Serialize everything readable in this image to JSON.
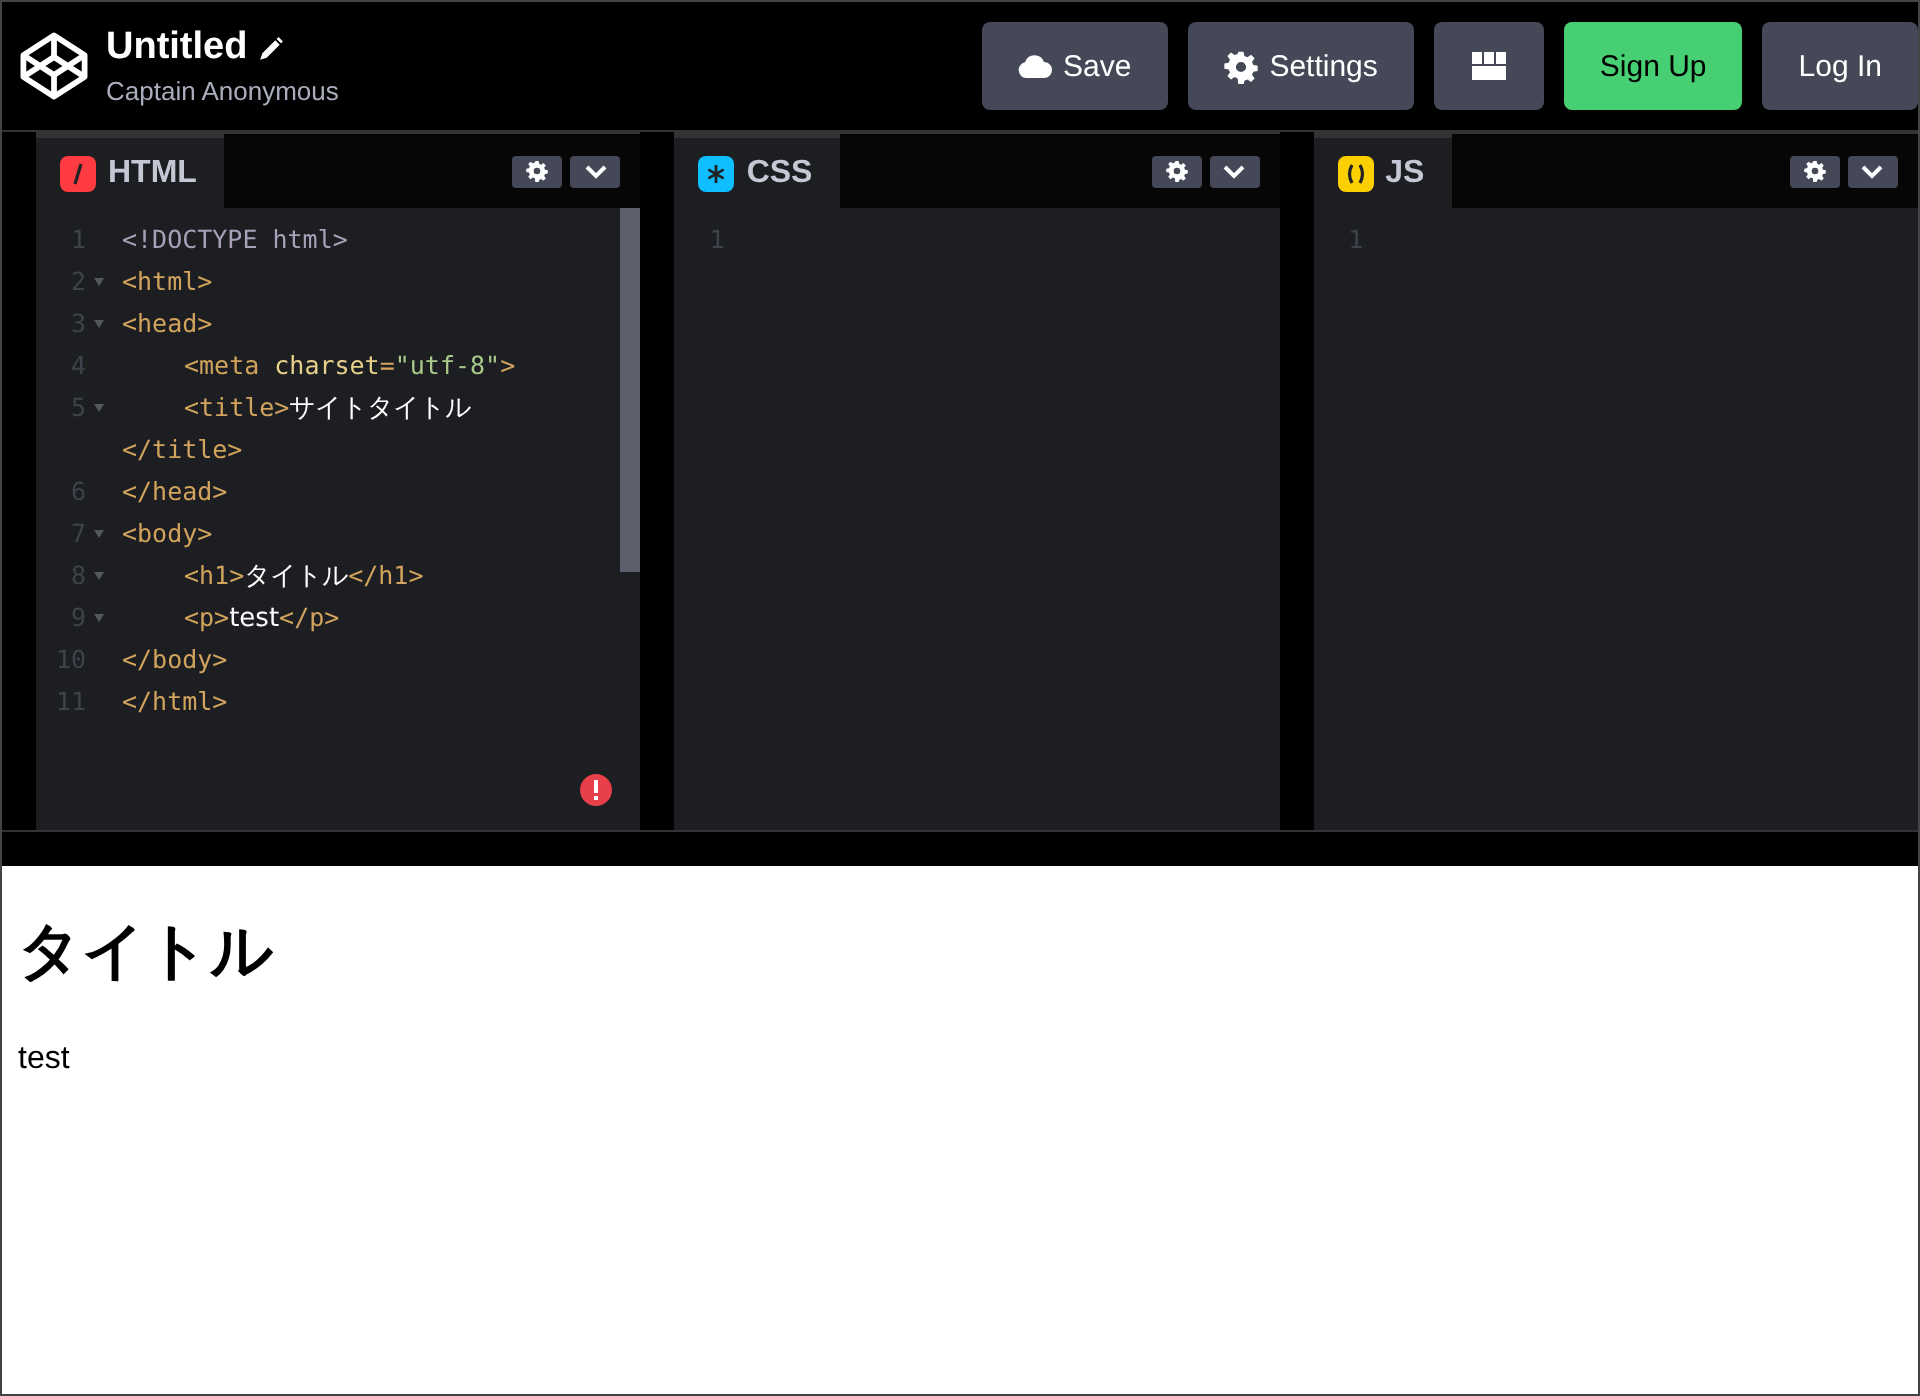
{
  "header": {
    "title": "Untitled",
    "author": "Captain Anonymous",
    "buttons": [
      {
        "kind": "save",
        "label": "Save"
      },
      {
        "kind": "settings",
        "label": "Settings"
      },
      {
        "kind": "layout"
      },
      {
        "kind": "signup",
        "label": "Sign Up"
      },
      {
        "kind": "login",
        "label": "Log In"
      }
    ]
  },
  "editors": [
    {
      "kind": "html",
      "label": "HTML",
      "scrollbar": true,
      "error": true,
      "lines": [
        {
          "number": "1",
          "foldable": false,
          "tokens": [
            {
              "kind": "doctype",
              "text": "<!DOCTYPE html>"
            }
          ]
        },
        {
          "number": "2",
          "foldable": true,
          "tokens": [
            {
              "kind": "tag",
              "text": "<html>"
            }
          ]
        },
        {
          "number": "3",
          "foldable": true,
          "tokens": [
            {
              "kind": "tag",
              "text": "<head>"
            }
          ]
        },
        {
          "number": "4",
          "foldable": false,
          "indent": true,
          "tokens": [
            {
              "kind": "tag",
              "text": "<meta "
            },
            {
              "kind": "attr",
              "text": "charset"
            },
            {
              "kind": "tag",
              "text": "="
            },
            {
              "kind": "string",
              "text": "\"utf-8\""
            },
            {
              "kind": "tag",
              "text": ">"
            }
          ]
        },
        {
          "number": "5",
          "foldable": true,
          "indent": true,
          "tokens": [
            {
              "kind": "tag",
              "text": "<title>"
            },
            {
              "kind": "text",
              "text": "サイトタイトル"
            }
          ]
        },
        {
          "foldable": false,
          "tokens": [
            {
              "kind": "tag",
              "text": "</title>"
            }
          ]
        },
        {
          "number": "6",
          "foldable": false,
          "tokens": [
            {
              "kind": "tag",
              "text": "</head>"
            }
          ]
        },
        {
          "number": "7",
          "foldable": true,
          "tokens": [
            {
              "kind": "tag",
              "text": "<body>"
            }
          ]
        },
        {
          "number": "8",
          "foldable": true,
          "indent": true,
          "tokens": [
            {
              "kind": "tag",
              "text": "<h1>"
            },
            {
              "kind": "text",
              "text": "タイトル"
            },
            {
              "kind": "tag",
              "text": "</h1>"
            }
          ]
        },
        {
          "number": "9",
          "foldable": true,
          "indent": true,
          "tokens": [
            {
              "kind": "tag",
              "text": "<p>"
            },
            {
              "kind": "text",
              "text": "test"
            },
            {
              "kind": "tag",
              "text": "</p>"
            }
          ]
        },
        {
          "number": "10",
          "foldable": false,
          "tokens": [
            {
              "kind": "tag",
              "text": "</body>"
            }
          ]
        },
        {
          "number": "11",
          "foldable": false,
          "tokens": [
            {
              "kind": "tag",
              "text": "</html>"
            }
          ]
        }
      ]
    },
    {
      "kind": "css",
      "label": "CSS",
      "scrollbar": false,
      "error": false,
      "lines": [
        {
          "number": "1",
          "foldable": false
        }
      ]
    },
    {
      "kind": "js",
      "label": "JS",
      "scrollbar": false,
      "error": false,
      "lines": [
        {
          "number": "1",
          "foldable": false
        }
      ]
    }
  ],
  "preview": {
    "heading": "タイトル",
    "paragraph": "test"
  }
}
